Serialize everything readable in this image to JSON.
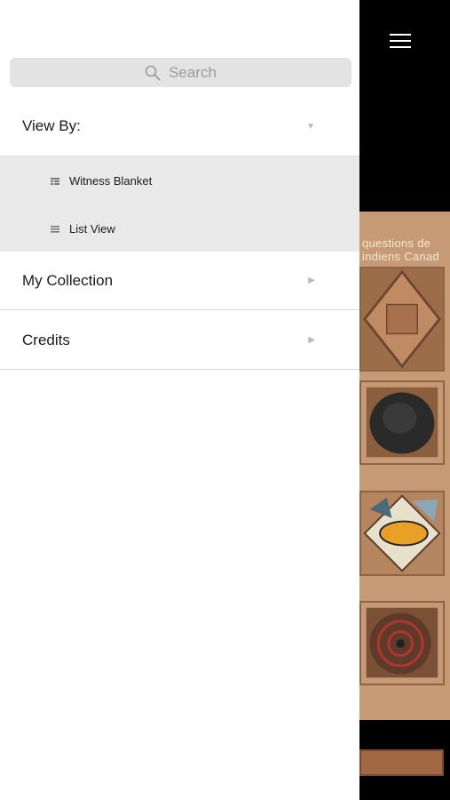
{
  "search": {
    "placeholder": "Search",
    "icon": "search-icon"
  },
  "menu": {
    "view_by": {
      "label": "View By:",
      "chevron": "▼"
    },
    "view_options": [
      {
        "label": "Witness Blanket",
        "icon": "grid-icon"
      },
      {
        "label": "List View",
        "icon": "list-icon"
      }
    ],
    "items": [
      {
        "label": "My Collection",
        "chevron": "▶"
      },
      {
        "label": "Credits",
        "chevron": "▶"
      }
    ]
  },
  "main": {
    "caption_line1": "questions de",
    "caption_line2": "indiens Canad",
    "colors": {
      "bg": "#000000",
      "wood": "#c79a76"
    }
  }
}
